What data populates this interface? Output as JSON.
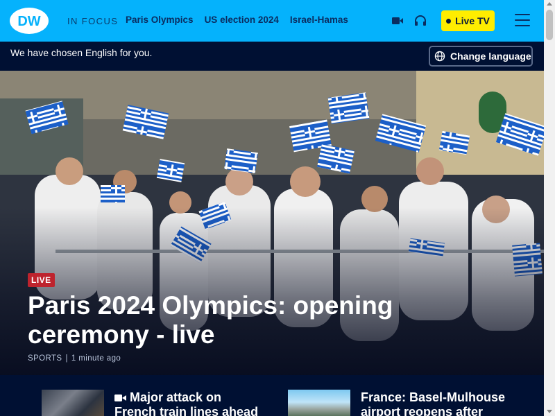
{
  "header": {
    "logo_text": "DW",
    "in_focus_label": "IN FOCUS",
    "nav_links": [
      "Paris Olympics",
      "US election 2024",
      "Israel-Hamas"
    ],
    "video_icon": "video-camera-icon",
    "audio_icon": "headphones-icon",
    "live_tv_label": "Live TV",
    "menu_icon": "hamburger-menu-icon",
    "brand_color": "#05b2fc",
    "accent_color": "#ffed00"
  },
  "language_bar": {
    "message": "We have chosen English for you.",
    "button_label": "Change language",
    "button_icon": "globe-icon"
  },
  "hero": {
    "badge": "LIVE",
    "badge_color": "#be232d",
    "title": "Paris 2024 Olympics: opening ceremony - live",
    "category": "SPORTS",
    "separator": "|",
    "timestamp": "1 minute ago"
  },
  "teasers": [
    {
      "title_line1": "Major attack on",
      "title_line2": "French train lines ahead",
      "icon": "video-camera-icon"
    },
    {
      "title_line1": "France: Basel-Mulhouse",
      "title_line2": "airport reopens after"
    }
  ]
}
